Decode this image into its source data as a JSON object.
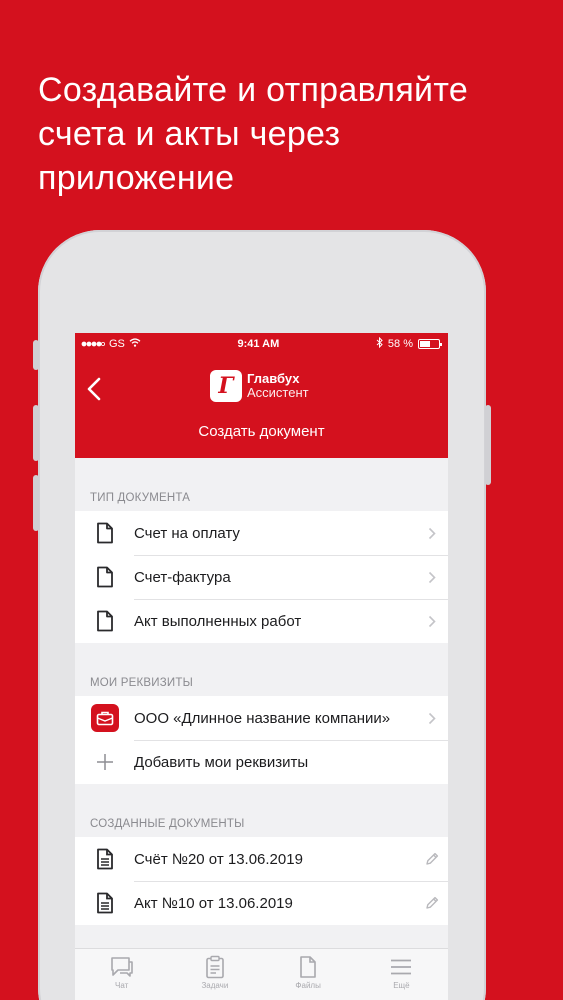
{
  "headline": {
    "line1": "Создавайте и отправляйте",
    "line2": "счета и акты через",
    "line3": "приложение"
  },
  "status_bar": {
    "carrier": "GS",
    "time": "9:41 AM",
    "battery": "58 %",
    "battery_level": 0.58
  },
  "nav": {
    "logo_glyph": "Г",
    "logo_name": "Главбух",
    "logo_sub": "Ассистент",
    "title": "Создать документ"
  },
  "doc_types": {
    "header": "ТИП ДОКУМЕНТА",
    "items": [
      {
        "label": "Счет на оплату",
        "icon": "document-icon"
      },
      {
        "label": "Счет-фактура",
        "icon": "document-icon"
      },
      {
        "label": "Акт выполненных работ",
        "icon": "document-icon"
      }
    ]
  },
  "requisites": {
    "header": "МОИ РЕКВИЗИТЫ",
    "company": "ООО «Длинное название компании»",
    "add_label": "Добавить мои реквизиты"
  },
  "created": {
    "header": "СОЗДАННЫЕ ДОКУМЕНТЫ",
    "items": [
      {
        "label": "Счёт №20 от 13.06.2019",
        "icon": "document-lines-icon"
      },
      {
        "label": "Акт №10 от 13.06.2019",
        "icon": "document-lines-icon"
      }
    ]
  },
  "tabs": [
    {
      "label": "Чат",
      "icon": "chat-icon"
    },
    {
      "label": "Задачи",
      "icon": "clipboard-icon"
    },
    {
      "label": "Файлы",
      "icon": "file-icon"
    },
    {
      "label": "Ещё",
      "icon": "menu-icon"
    }
  ],
  "colors": {
    "brand_red": "#d4111e",
    "screen_bg": "#f1f1f3",
    "text": "#1c1c1e",
    "muted": "#8a8a8f"
  }
}
